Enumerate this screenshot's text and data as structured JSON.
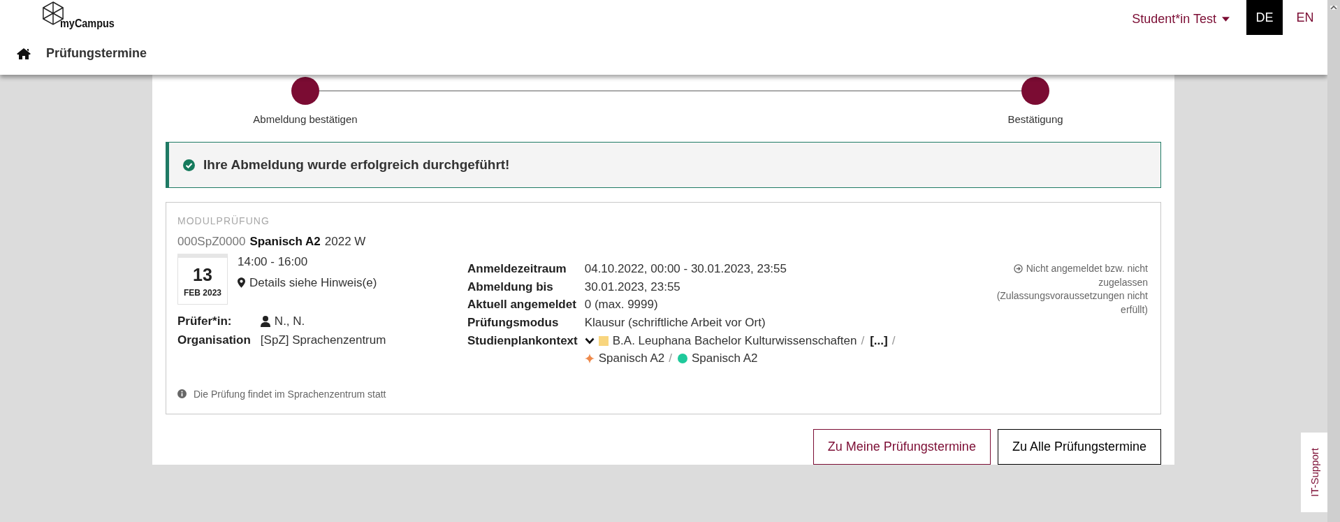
{
  "header": {
    "logo_text": "myCampus",
    "breadcrumb": "Prüfungstermine",
    "user_menu": "Student*in Test",
    "languages": [
      {
        "label": "DE",
        "selected": true
      },
      {
        "label": "EN",
        "selected": false
      }
    ]
  },
  "steps": [
    {
      "label": "Abmeldung bestätigen"
    },
    {
      "label": "Bestätigung"
    }
  ],
  "alert": {
    "message": "Ihre Abmeldung wurde erfolgreich durchgeführt!"
  },
  "exam": {
    "type": "MODULPRÜFUNG",
    "code": "000SpZ0000",
    "title": "Spanisch A2",
    "term": "2022 W",
    "date": {
      "day": "13",
      "month_year": "FEB 2023"
    },
    "time": "14:00 - 16:00",
    "location": "Details siehe Hinweis(e)",
    "people": [
      {
        "label": "Prüfer*in:",
        "value": "N., N.",
        "kind": "person"
      },
      {
        "label": "Organisation",
        "value": "[SpZ] Sprachenzentrum",
        "kind": "plain"
      }
    ],
    "details": [
      {
        "label": "Anmeldezeitraum",
        "value": "04.10.2022, 00:00 - 30.01.2023, 23:55"
      },
      {
        "label": "Abmeldung bis",
        "value": "30.01.2023, 23:55"
      },
      {
        "label": "Aktuell angemeldet",
        "value": "0 (max. 9999)"
      },
      {
        "label": "Prüfungsmodus",
        "value": "Klausur (schriftliche Arbeit vor Ort)"
      }
    ],
    "context": {
      "label": "Studienplankontext",
      "expanded": true,
      "separator": "/",
      "items": [
        {
          "kind": "square",
          "color": "#f8d57e",
          "text": "B.A. Leuphana Bachelor Kulturwissenschaften"
        },
        {
          "kind": "ellipsis",
          "text": "[...]"
        },
        {
          "kind": "diamond",
          "color": "#ee8a4c",
          "text": "Spanisch A2"
        },
        {
          "kind": "dot",
          "color": "#1ec99b",
          "text": "Spanisch A2"
        }
      ]
    },
    "status": "Nicht angemeldet bzw. nicht zugelassen (Zulassungsvoraussetzungen nicht erfüllt)",
    "note": "Die Prüfung findet im Sprachenzentrum statt"
  },
  "buttons": [
    {
      "label": "Zu Meine Prüfungstermine",
      "kind": "primary"
    },
    {
      "label": "Zu Alle Prüfungstermine",
      "kind": "secondary"
    }
  ],
  "it_support": "IT-Support"
}
